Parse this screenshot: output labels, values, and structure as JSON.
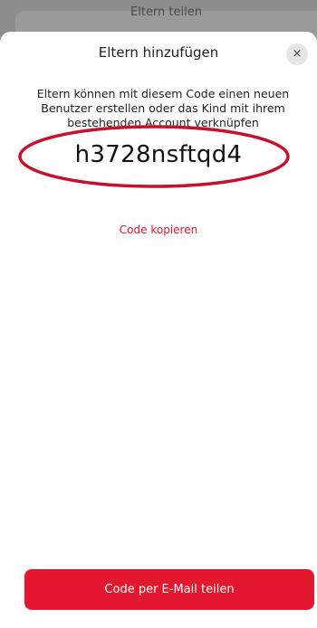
{
  "background": {
    "title_partial": "Eltern teilen"
  },
  "modal": {
    "title": "Eltern hinzufügen",
    "close_glyph": "×",
    "description": "Eltern können mit diesem Code einen neuen Benutzer erstellen oder das Kind mit ihrem bestehenden Account verknüpfen",
    "code": "h3728nsftqd4",
    "copy_label": "Code kopieren",
    "share_button_label": "Code per E-Mail teilen"
  },
  "colors": {
    "accent": "#e3172d",
    "backdrop": "#8d8d8d"
  }
}
